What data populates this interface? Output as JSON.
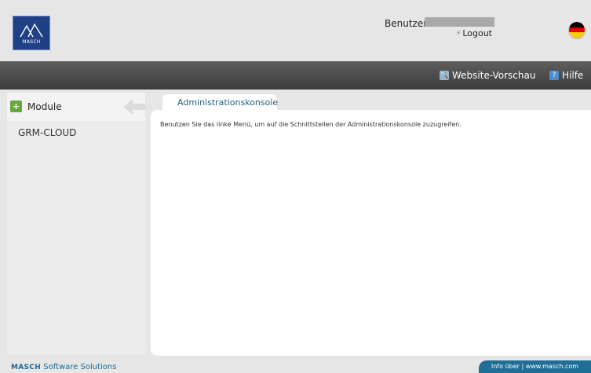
{
  "header": {
    "logo_text": "MASCH",
    "user_label": "Benutzer:",
    "logout_label": "Logout",
    "language_flag": "german-flag-icon"
  },
  "topbar": {
    "preview_label": "Website-Vorschau",
    "help_label": "Hilfe"
  },
  "sidebar": {
    "title": "Module",
    "items": [
      {
        "label": "GRM-CLOUD"
      }
    ]
  },
  "main": {
    "tab_label": "Administrationskonsole",
    "body_text": "Benutzen Sie das linke Menü, um auf die Schnittstellen der Administrationskonsole zuzugreifen."
  },
  "footer": {
    "brand": "MASCH",
    "brand_suffix": "Software Solutions",
    "info_link": "Info über | www.masch.com"
  },
  "colors": {
    "accent_blue": "#1e6e95",
    "logo_blue": "#1f3f87",
    "topbar": "#4a4a4a",
    "module_green": "#67a83a"
  }
}
